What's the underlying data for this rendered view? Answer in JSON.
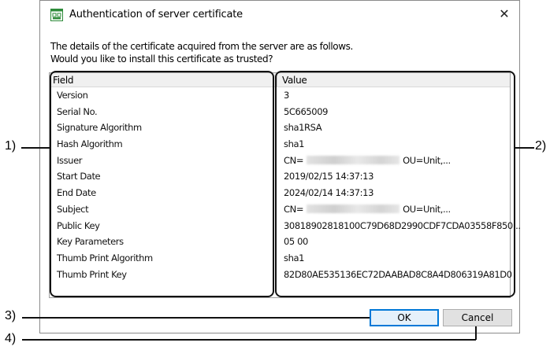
{
  "dialog": {
    "title": "Authentication of server certificate",
    "close_glyph": "✕",
    "message_line1": "The details of the certificate acquired from the server are as follows.",
    "message_line2": "Would you like to install this certificate as trusted?",
    "columns": {
      "field": "Field",
      "value": "Value"
    },
    "rows": [
      {
        "field": "Version",
        "value": "3"
      },
      {
        "field": "Serial No.",
        "value": "5C665009"
      },
      {
        "field": "Signature Algorithm",
        "value": "sha1RSA"
      },
      {
        "field": "Hash Algorithm",
        "value": "sha1"
      },
      {
        "field": "Issuer",
        "value_prefix": "CN=",
        "value_suffix": "OU=Unit,..."
      },
      {
        "field": "Start Date",
        "value": "2019/02/15 14:37:13"
      },
      {
        "field": "End Date",
        "value": "2024/02/14 14:37:13"
      },
      {
        "field": "Subject",
        "value_prefix": "CN=",
        "value_suffix": "OU=Unit,..."
      },
      {
        "field": "Public Key",
        "value": "30818902818100C79D68D2990CDF7CDA03558F850..."
      },
      {
        "field": "Key Parameters",
        "value": "05 00"
      },
      {
        "field": "Thumb Print Algorithm",
        "value": "sha1"
      },
      {
        "field": "Thumb Print Key",
        "value": "82D80AE535136EC72DAABAD8C8A4D806319A81D0"
      }
    ],
    "ok_label": "OK",
    "cancel_label": "Cancel"
  },
  "callouts": {
    "label1": "1)",
    "label2": "2)",
    "label3": "3)",
    "label4": "4)"
  },
  "icons": {
    "app_icon": "certificate-window-icon",
    "close_icon": "close-icon"
  },
  "colors": {
    "accent": "#0078d7",
    "app_icon_green": "#2e8b3a"
  }
}
